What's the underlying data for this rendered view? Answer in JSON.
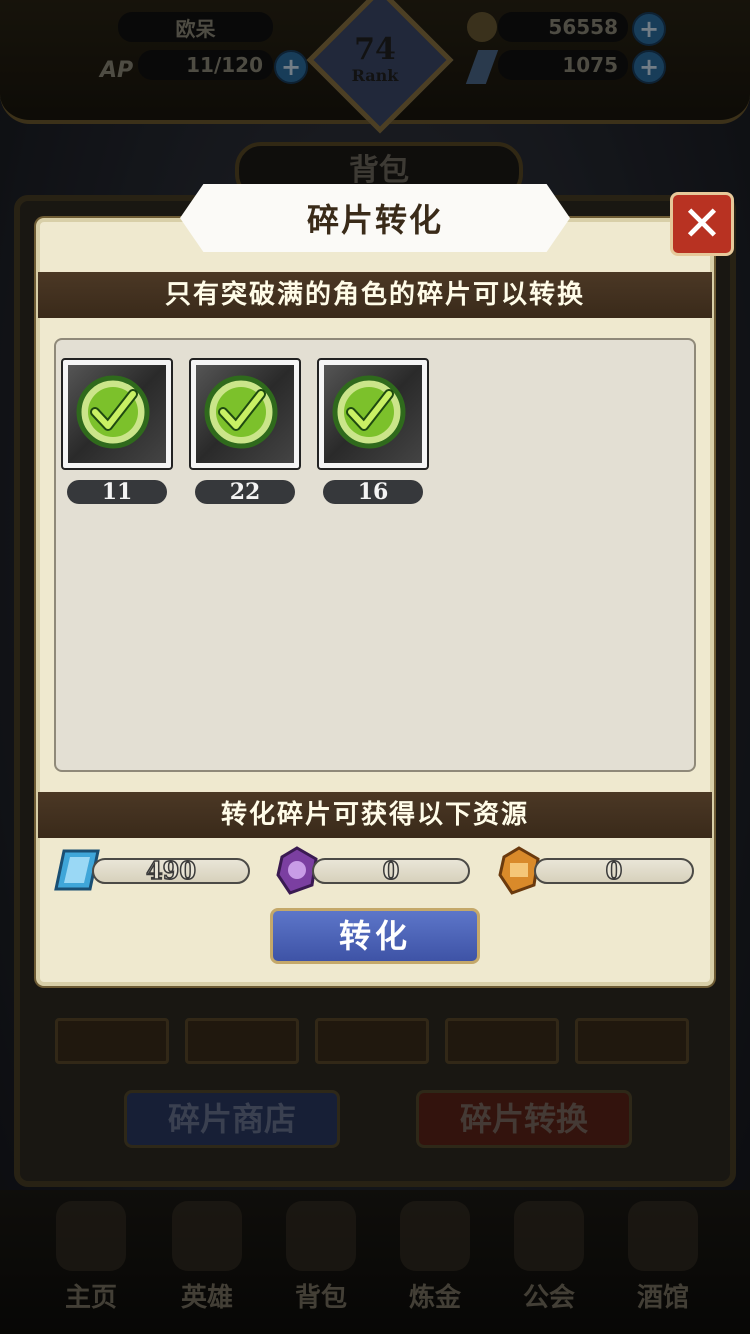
{
  "header": {
    "player_name": "欧呆",
    "ap_label": "AP",
    "ap_value": "11/120",
    "rank_number": "74",
    "rank_label": "Rank",
    "gold": "56558",
    "crystals": "1075"
  },
  "bag": {
    "title": "背包",
    "shop_button": "碎片商店",
    "convert_button": "碎片转换"
  },
  "nav": {
    "items": [
      {
        "label": "主页",
        "icon": "castle-icon"
      },
      {
        "label": "英雄",
        "icon": "helmet-icon"
      },
      {
        "label": "背包",
        "icon": "bag-icon"
      },
      {
        "label": "炼金",
        "icon": "potion-icon"
      },
      {
        "label": "公会",
        "icon": "guild-shield-icon"
      },
      {
        "label": "酒馆",
        "icon": "tavern-icon"
      }
    ]
  },
  "modal": {
    "title": "碎片转化",
    "notice": "只有突破满的角色的碎片可以转换",
    "fragments": [
      {
        "count": "11",
        "selected": true
      },
      {
        "count": "22",
        "selected": true
      },
      {
        "count": "16",
        "selected": true
      }
    ],
    "rewards_banner": "转化碎片可获得以下资源",
    "rewards": [
      {
        "icon": "blue-crystal-icon",
        "value": "490",
        "color": "#3fa6d9"
      },
      {
        "icon": "purple-gem-icon",
        "value": "0",
        "color": "#7b3fa1"
      },
      {
        "icon": "orange-gem-icon",
        "value": "0",
        "color": "#d98a2a"
      }
    ],
    "convert_button": "转化"
  },
  "colors": {
    "modal_bg": "#efe9cf",
    "banner_bg": "#3a2a1a",
    "close_red": "#b83222",
    "check_green": "#7cc12b",
    "button_blue": "#4a5fb5"
  }
}
